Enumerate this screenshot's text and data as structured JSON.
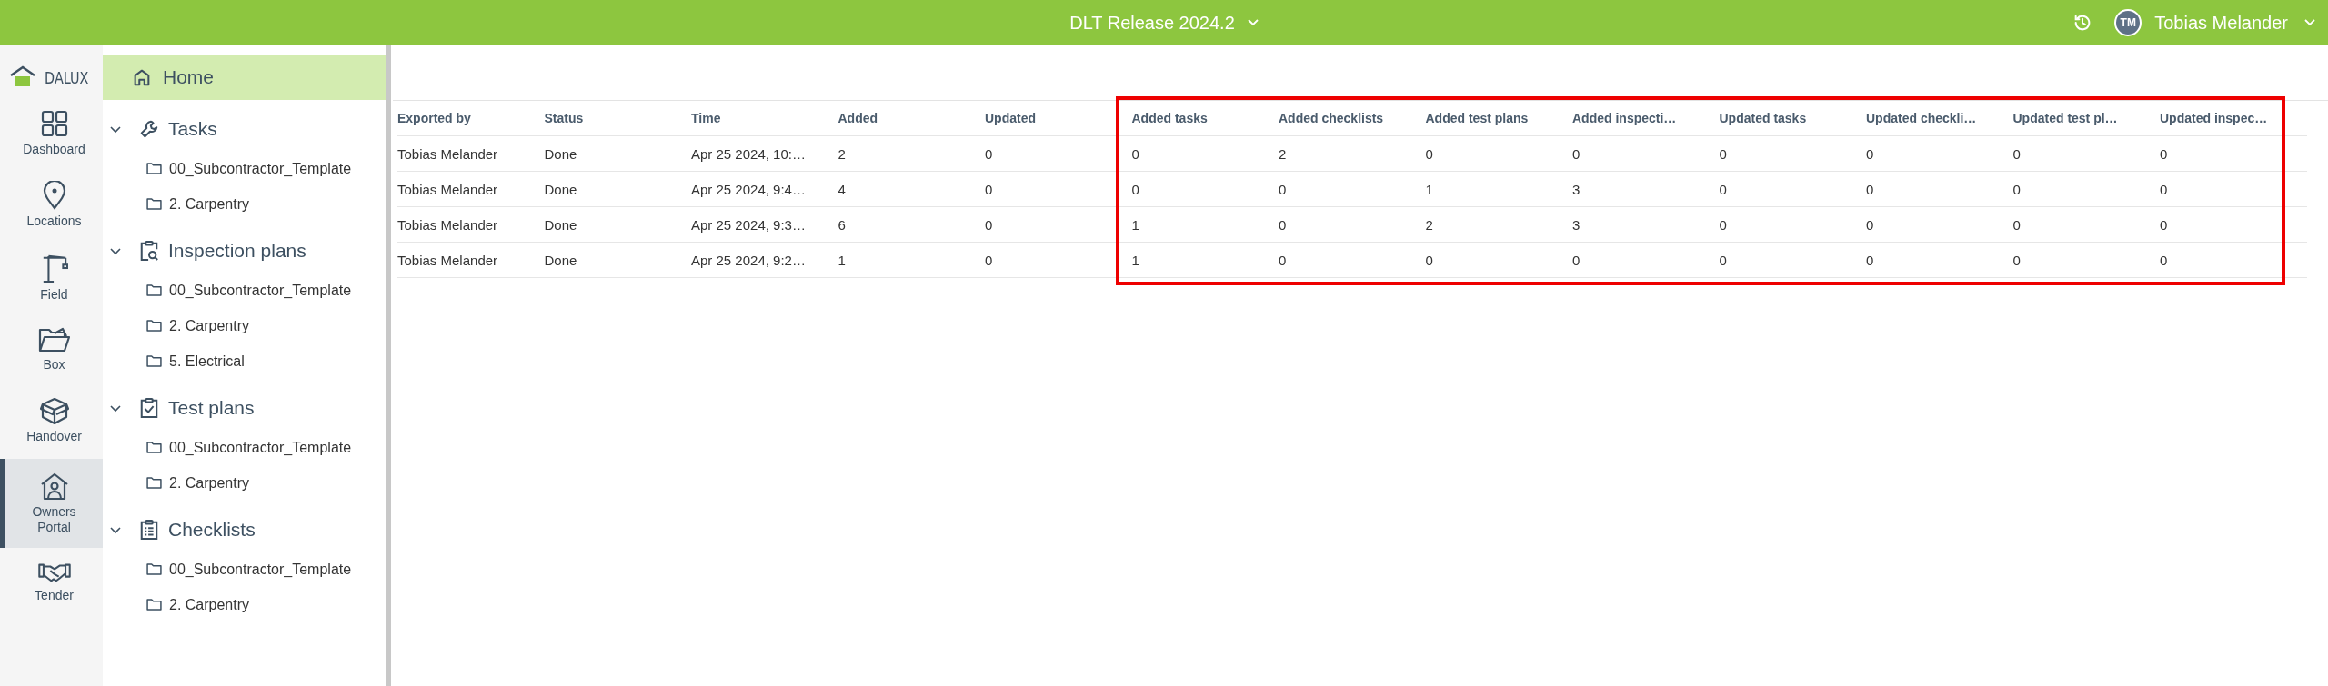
{
  "topbar": {
    "title": "DLT Release 2024.2",
    "user": {
      "initials": "TM",
      "name": "Tobias Melander"
    }
  },
  "rail": {
    "logo": "DALUX",
    "items": [
      {
        "label": "Dashboard",
        "selected": false
      },
      {
        "label": "Locations",
        "selected": false
      },
      {
        "label": "Field",
        "selected": false
      },
      {
        "label": "Box",
        "selected": false
      },
      {
        "label": "Handover",
        "selected": false
      },
      {
        "label": "Owners Portal",
        "selected": true
      },
      {
        "label": "Tender",
        "selected": false
      }
    ]
  },
  "sidebar": {
    "home": {
      "label": "Home",
      "selected": true
    },
    "sections": [
      {
        "label": "Tasks",
        "expanded": true,
        "children": [
          {
            "label": "00_Subcontractor_Template"
          },
          {
            "label": "2. Carpentry"
          }
        ]
      },
      {
        "label": "Inspection plans",
        "expanded": true,
        "children": [
          {
            "label": "00_Subcontractor_Template"
          },
          {
            "label": "2. Carpentry"
          },
          {
            "label": "5. Electrical"
          }
        ]
      },
      {
        "label": "Test plans",
        "expanded": true,
        "children": [
          {
            "label": "00_Subcontractor_Template"
          },
          {
            "label": "2. Carpentry"
          }
        ]
      },
      {
        "label": "Checklists",
        "expanded": true,
        "children": [
          {
            "label": "00_Subcontractor_Template"
          },
          {
            "label": "2. Carpentry"
          }
        ]
      }
    ]
  },
  "table": {
    "columns": [
      {
        "label": "Exported by",
        "highlighted": false
      },
      {
        "label": "Status",
        "highlighted": false
      },
      {
        "label": "Time",
        "highlighted": false
      },
      {
        "label": "Added",
        "highlighted": false
      },
      {
        "label": "Updated",
        "highlighted": false
      },
      {
        "label": "Added tasks",
        "highlighted": true
      },
      {
        "label": "Added checklists",
        "highlighted": true
      },
      {
        "label": "Added test plans",
        "highlighted": true
      },
      {
        "label": "Added inspecti…",
        "highlighted": true
      },
      {
        "label": "Updated tasks",
        "highlighted": true
      },
      {
        "label": "Updated checkli…",
        "highlighted": true
      },
      {
        "label": "Updated test pl…",
        "highlighted": true
      },
      {
        "label": "Updated inspec…",
        "highlighted": true
      }
    ],
    "rows": [
      [
        "Tobias Melander",
        "Done",
        "Apr 25 2024, 10:…",
        "2",
        "0",
        "0",
        "2",
        "0",
        "0",
        "0",
        "0",
        "0",
        "0"
      ],
      [
        "Tobias Melander",
        "Done",
        "Apr 25 2024, 9:4…",
        "4",
        "0",
        "0",
        "0",
        "1",
        "3",
        "0",
        "0",
        "0",
        "0"
      ],
      [
        "Tobias Melander",
        "Done",
        "Apr 25 2024, 9:3…",
        "6",
        "0",
        "1",
        "0",
        "2",
        "3",
        "0",
        "0",
        "0",
        "0"
      ],
      [
        "Tobias Melander",
        "Done",
        "Apr 25 2024, 9:2…",
        "1",
        "0",
        "1",
        "0",
        "0",
        "0",
        "0",
        "0",
        "0",
        "0"
      ]
    ]
  }
}
